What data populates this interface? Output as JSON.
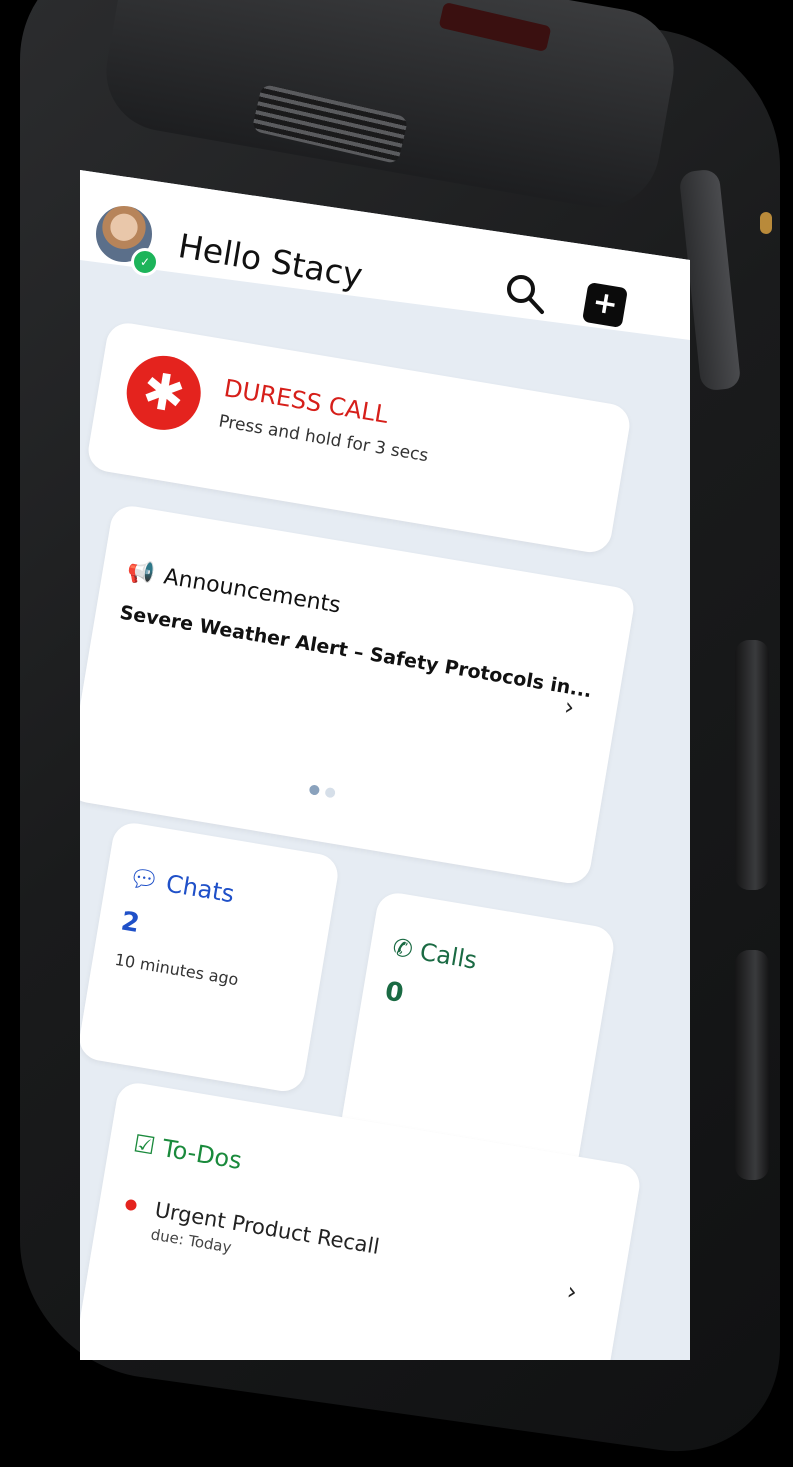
{
  "header": {
    "greeting": "Hello Stacy",
    "status": "online"
  },
  "duress": {
    "title": "DURESS CALL",
    "subtitle": "Press and hold for 3 secs",
    "icon": "asterisk-icon",
    "color": "#e4231e"
  },
  "announcements": {
    "label": "Announcements",
    "icon": "megaphone-icon",
    "headline": "Severe Weather Alert – Safety Protocols in...",
    "chevron": "›",
    "pager": {
      "total": 2,
      "active": 1
    }
  },
  "chats": {
    "label": "Chats",
    "icon": "chat-bubble-icon",
    "count": "2",
    "timestamp": "10 minutes ago",
    "color": "#1f50c8"
  },
  "calls": {
    "label": "Calls",
    "icon": "phone-icon",
    "count": "0",
    "color": "#1a6a43"
  },
  "todos": {
    "label": "To-Dos",
    "icon": "checklist-icon",
    "color": "#1a8a3c",
    "items": [
      {
        "title": "Urgent Product Recall",
        "due": "due: Today",
        "bullet_color": "#e4231e",
        "chevron": "›"
      }
    ]
  }
}
